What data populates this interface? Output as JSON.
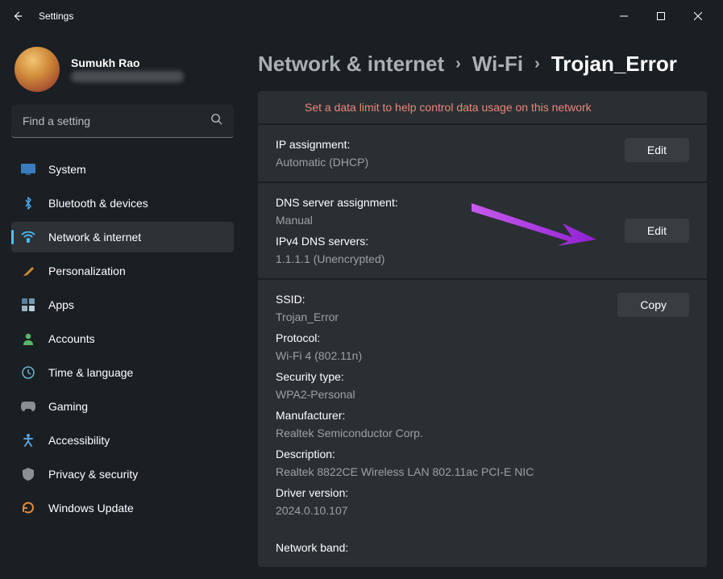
{
  "window": {
    "title": "Settings"
  },
  "user": {
    "name": "Sumukh Rao"
  },
  "search": {
    "placeholder": "Find a setting"
  },
  "nav": {
    "items": [
      {
        "id": "system",
        "label": "System"
      },
      {
        "id": "bluetooth",
        "label": "Bluetooth & devices"
      },
      {
        "id": "network",
        "label": "Network & internet",
        "active": true
      },
      {
        "id": "personalization",
        "label": "Personalization"
      },
      {
        "id": "apps",
        "label": "Apps"
      },
      {
        "id": "accounts",
        "label": "Accounts"
      },
      {
        "id": "time",
        "label": "Time & language"
      },
      {
        "id": "gaming",
        "label": "Gaming"
      },
      {
        "id": "accessibility",
        "label": "Accessibility"
      },
      {
        "id": "privacy",
        "label": "Privacy & security"
      },
      {
        "id": "update",
        "label": "Windows Update"
      }
    ]
  },
  "breadcrumb": {
    "root": "Network & internet",
    "mid": "Wi-Fi",
    "current": "Trojan_Error"
  },
  "banner": {
    "text": "Set a data limit to help control data usage on this network"
  },
  "sections": {
    "ip": {
      "label": "IP assignment:",
      "value": "Automatic (DHCP)",
      "button": "Edit"
    },
    "dns": {
      "label": "DNS server assignment:",
      "value": "Manual",
      "label2": "IPv4 DNS servers:",
      "value2": "1.1.1.1 (Unencrypted)",
      "button": "Edit"
    },
    "details": {
      "button": "Copy",
      "rows": [
        {
          "label": "SSID:",
          "value": "Trojan_Error"
        },
        {
          "label": "Protocol:",
          "value": "Wi-Fi 4 (802.11n)"
        },
        {
          "label": "Security type:",
          "value": "WPA2-Personal"
        },
        {
          "label": "Manufacturer:",
          "value": "Realtek Semiconductor Corp."
        },
        {
          "label": "Description:",
          "value": "Realtek 8822CE Wireless LAN 802.11ac PCI-E NIC"
        },
        {
          "label": "Driver version:",
          "value": "2024.0.10.107"
        }
      ],
      "band_label": "Network band:"
    }
  },
  "colors": {
    "accent": "#4cc2ff",
    "banner": "#ee8679",
    "arrow": "#a020f0"
  }
}
